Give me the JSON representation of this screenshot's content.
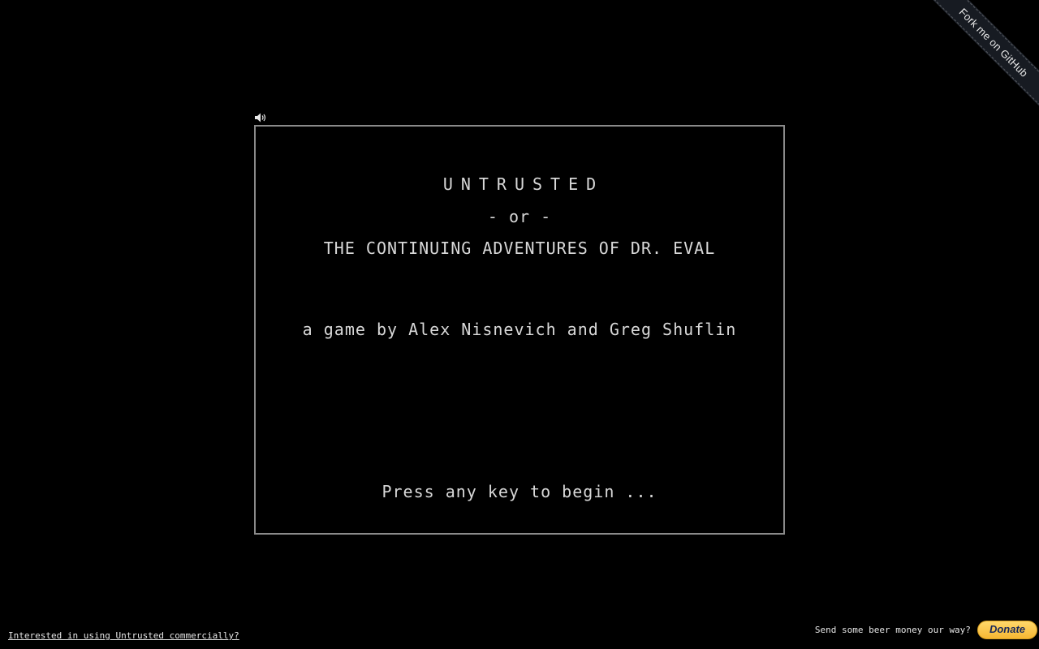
{
  "ribbon": {
    "label": "Fork me on GitHub"
  },
  "sound": {
    "icon": "speaker-icon"
  },
  "screen": {
    "title": "UNTRUSTED",
    "or_line": "- or -",
    "subtitle": "THE CONTINUING ADVENTURES OF DR. EVAL",
    "credits": "a game by Alex Nisnevich and Greg Shuflin",
    "prompt": "Press any key to begin ..."
  },
  "footer": {
    "commercial_link": "Interested in using Untrusted commercially?",
    "donate_text": "Send some beer money our way?",
    "donate_label": "Donate"
  },
  "colors": {
    "background": "#000000",
    "text": "#d8d8d8",
    "screen_border": "#8a8a8a",
    "donate_button": "#f7b733"
  }
}
